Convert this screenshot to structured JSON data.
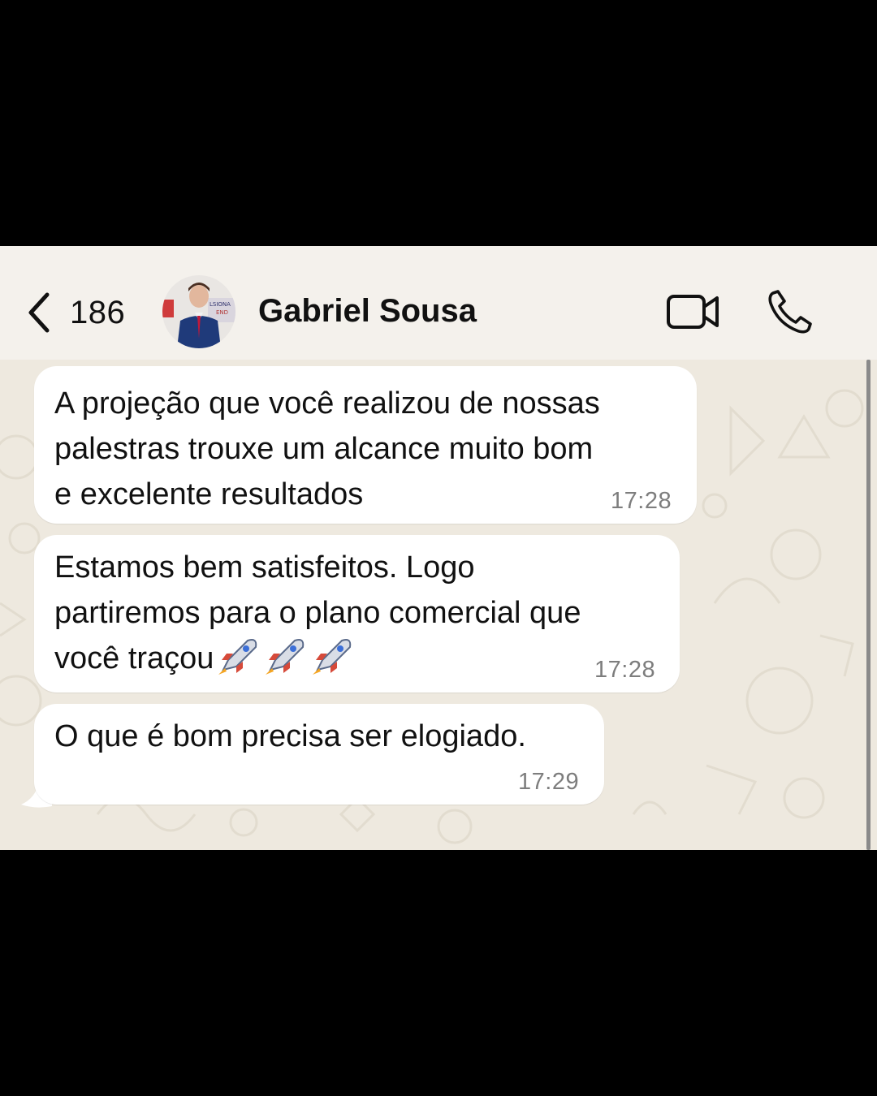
{
  "header": {
    "back_count": "186",
    "contact_name": "Gabriel Sousa",
    "icons": {
      "back": "chevron-left-icon",
      "video": "video-camera-icon",
      "call": "phone-icon"
    }
  },
  "messages": [
    {
      "text": "A projeção que você realizou de nossas\npalestras trouxe um alcance muito bom\ne excelente resultados",
      "time": "17:28"
    },
    {
      "text": "Estamos bem satisfeitos. Logo\npartiremos para o plano comercial que\nvocê traçou",
      "emoji": "🚀🚀🚀",
      "time": "17:28"
    },
    {
      "text": "O que é bom precisa ser elogiado.",
      "time": "17:29"
    }
  ],
  "colors": {
    "header_bg": "#f4f1ec",
    "chat_bg": "#eee9df",
    "bubble_bg": "#ffffff",
    "text": "#111111",
    "timestamp": "#7d7d7d"
  }
}
